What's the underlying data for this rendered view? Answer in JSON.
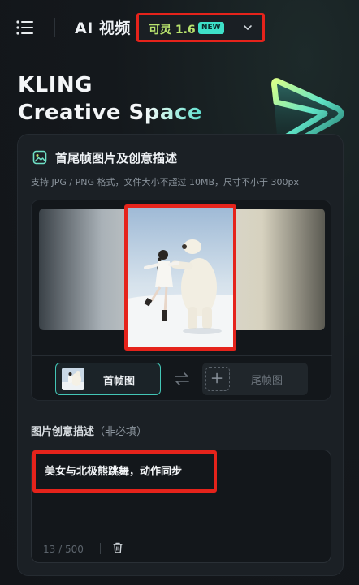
{
  "header": {
    "app_title": "AI 视频",
    "model_name": "可灵 1.6",
    "model_badge": "NEW"
  },
  "hero": {
    "line1": "KLING",
    "line2_a": "Creative S",
    "line2_b": "pace"
  },
  "section": {
    "title": "首尾帧图片及创意描述",
    "hint": "支持 JPG / PNG 格式，文件大小不超过 10MB，尺寸不小于 300px"
  },
  "frames": {
    "first_label": "首帧图",
    "last_label": "尾帧图"
  },
  "prompt": {
    "title": "图片创意描述",
    "optional": "（非必填）",
    "value": "美女与北极熊跳舞，动作同步",
    "counter": "13 / 500"
  },
  "colors": {
    "accent": "#43c6b6",
    "highlight_red": "#e5231b",
    "model_green": "#b8e26d",
    "badge": "#3ee0c8"
  },
  "icons": [
    "menu-icon",
    "chevron-down-icon",
    "kling-logo",
    "image-icon",
    "swap-icon",
    "plus-icon",
    "trash-icon"
  ]
}
